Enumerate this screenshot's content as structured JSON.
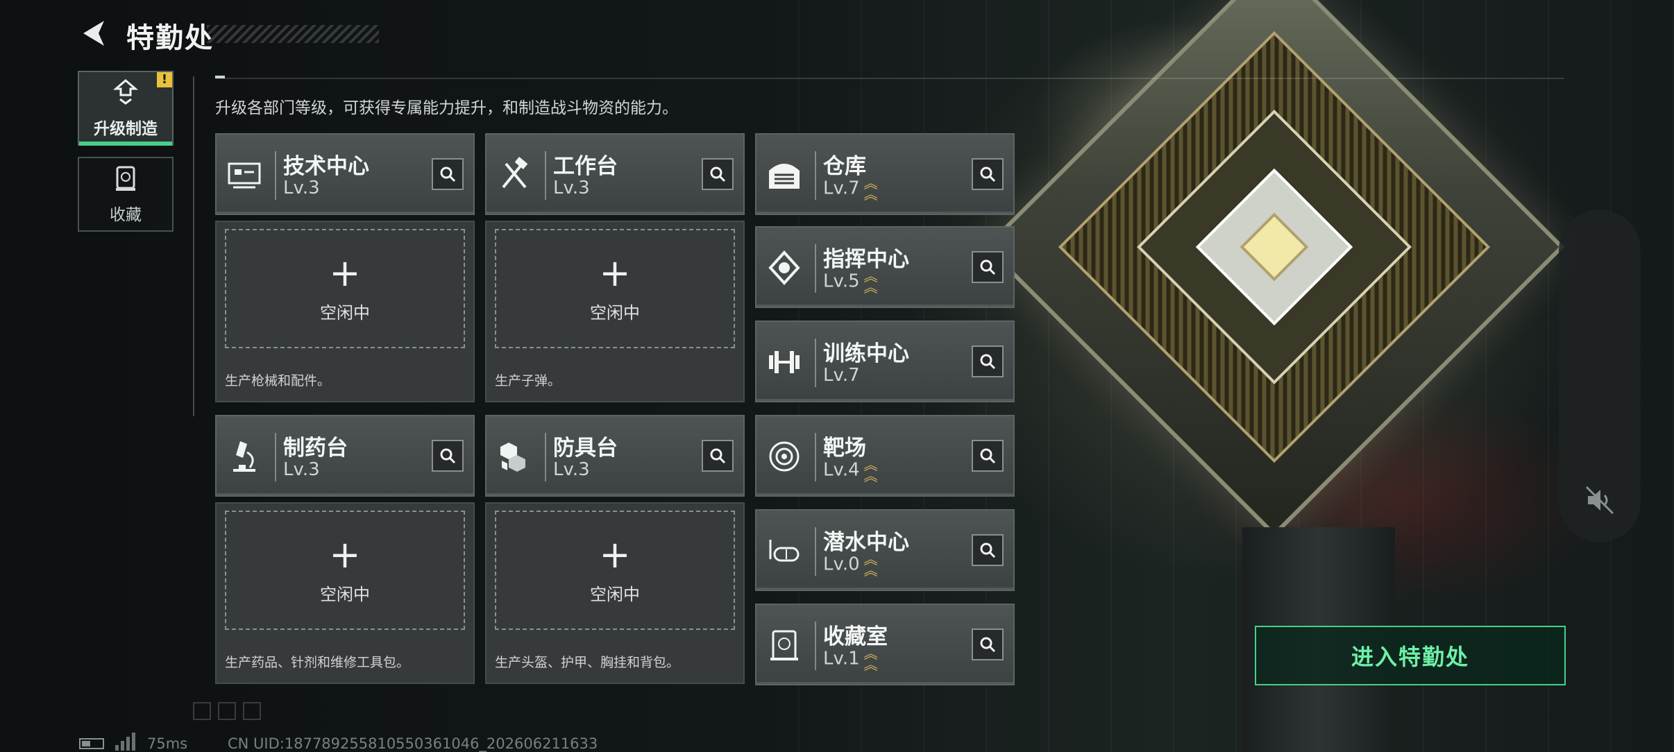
{
  "header": {
    "title": "特勤处"
  },
  "tabs": [
    {
      "label": "升级制造",
      "icon": "upgrade-arrows-icon",
      "active": true,
      "badge": "!"
    },
    {
      "label": "收藏",
      "icon": "collection-trophy-icon",
      "active": false
    }
  ],
  "description": "升级各部门等级，可获得专属能力提升，和制造战斗物资的能力。",
  "departments": [
    {
      "name": "技术中心",
      "level": "Lv.3",
      "icon": "tech-center-icon",
      "upgradable": false
    },
    {
      "name": "工作台",
      "level": "Lv.3",
      "icon": "hammer-wrench-icon",
      "upgradable": false
    },
    {
      "name": "仓库",
      "level": "Lv.7",
      "icon": "warehouse-icon",
      "upgradable": true
    },
    {
      "name": "指挥中心",
      "level": "Lv.5",
      "icon": "command-chip-icon",
      "upgradable": true
    },
    {
      "name": "训练中心",
      "level": "Lv.7",
      "icon": "dumbbell-icon",
      "upgradable": false
    },
    {
      "name": "制药台",
      "level": "Lv.3",
      "icon": "microscope-icon",
      "upgradable": false
    },
    {
      "name": "防具台",
      "level": "Lv.3",
      "icon": "armor-cubes-icon",
      "upgradable": false
    },
    {
      "name": "靶场",
      "level": "Lv.4",
      "icon": "target-icon",
      "upgradable": true
    },
    {
      "name": "潜水中心",
      "level": "Lv.0",
      "icon": "diving-mask-icon",
      "upgradable": true
    },
    {
      "name": "收藏室",
      "level": "Lv.1",
      "icon": "collection-room-icon",
      "upgradable": true
    }
  ],
  "slots": [
    {
      "plus": "+",
      "status": "空闲中",
      "hint": "生产枪械和配件。"
    },
    {
      "plus": "+",
      "status": "空闲中",
      "hint": "生产子弹。"
    },
    {
      "plus": "+",
      "status": "空闲中",
      "hint": "生产药品、针剂和维修工具包。"
    },
    {
      "plus": "+",
      "status": "空闲中",
      "hint": "生产头盔、护甲、胸挂和背包。"
    }
  ],
  "enter_button": "进入特勤处",
  "footer": {
    "ping": "75ms",
    "uid": "CN UID:18778925581055036​1046_202606211633"
  },
  "colors": {
    "accent": "#46d08a",
    "upgrade_chevron": "#d6b55a",
    "badge": "#e8c23a"
  }
}
